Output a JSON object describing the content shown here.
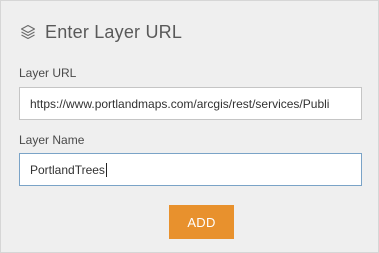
{
  "header": {
    "icon": "layers-icon",
    "title": "Enter Layer URL"
  },
  "form": {
    "url_label": "Layer URL",
    "url_value": "https://www.portlandmaps.com/arcgis/rest/services/Publi",
    "name_label": "Layer Name",
    "name_value": "PortlandTrees"
  },
  "actions": {
    "add_label": "ADD"
  },
  "colors": {
    "accent": "#e8912d",
    "panel_bg": "#efefef",
    "focus_border": "#7aa3c7"
  }
}
